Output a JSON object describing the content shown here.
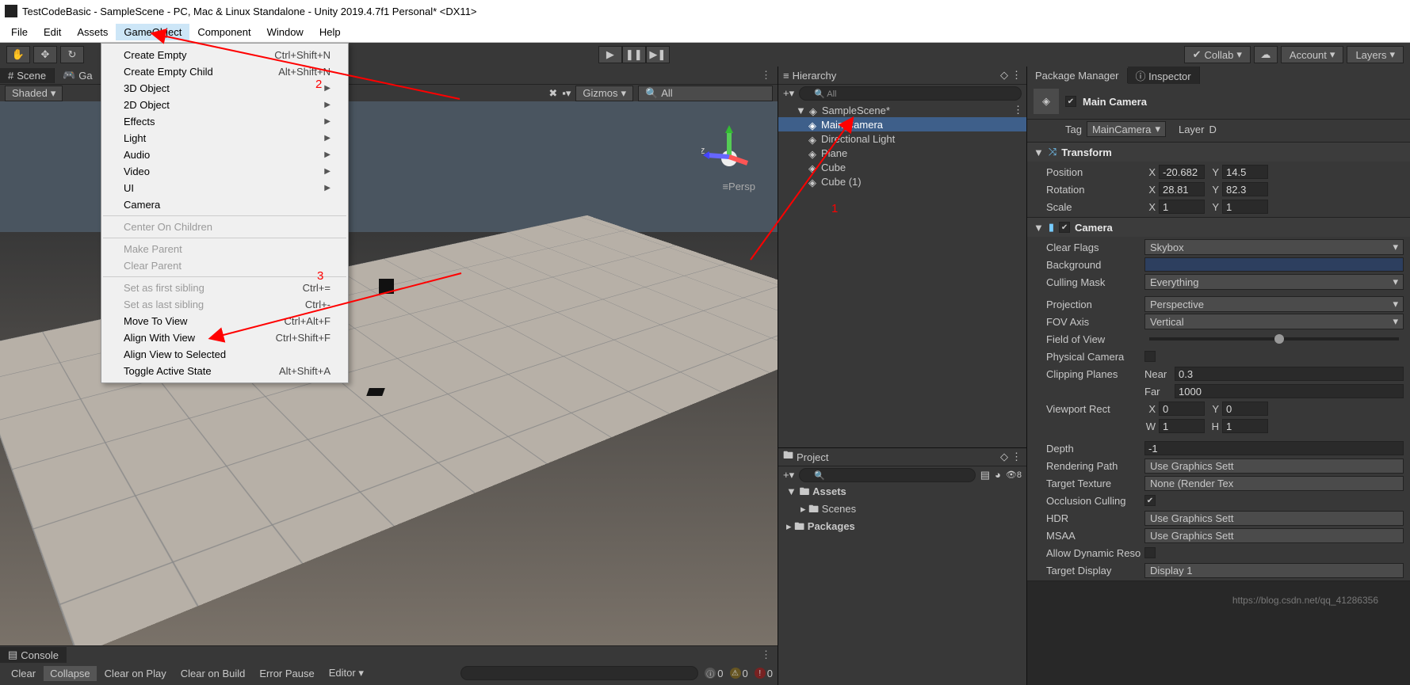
{
  "title": "TestCodeBasic - SampleScene - PC, Mac & Linux Standalone - Unity 2019.4.7f1 Personal* <DX11>",
  "menubar": [
    "File",
    "Edit",
    "Assets",
    "GameObject",
    "Component",
    "Window",
    "Help"
  ],
  "menubar_active": 3,
  "toolbar_right": {
    "collab": "Collab",
    "account": "Account",
    "layers": "Layers"
  },
  "scene_tabs": {
    "scene": "Scene",
    "game": "Ga"
  },
  "scene_toolbar": {
    "shaded": "Shaded",
    "gizmos": "Gizmos",
    "all": "All",
    "persp": "Persp"
  },
  "gameobject_menu": [
    {
      "t": "item",
      "label": "Create Empty",
      "shortcut": "Ctrl+Shift+N"
    },
    {
      "t": "item",
      "label": "Create Empty Child",
      "shortcut": "Alt+Shift+N"
    },
    {
      "t": "sub",
      "label": "3D Object"
    },
    {
      "t": "sub",
      "label": "2D Object"
    },
    {
      "t": "sub",
      "label": "Effects"
    },
    {
      "t": "sub",
      "label": "Light"
    },
    {
      "t": "sub",
      "label": "Audio"
    },
    {
      "t": "sub",
      "label": "Video"
    },
    {
      "t": "sub",
      "label": "UI"
    },
    {
      "t": "item",
      "label": "Camera"
    },
    {
      "t": "sep"
    },
    {
      "t": "item",
      "label": "Center On Children",
      "disabled": true
    },
    {
      "t": "sep"
    },
    {
      "t": "item",
      "label": "Make Parent",
      "disabled": true
    },
    {
      "t": "item",
      "label": "Clear Parent",
      "disabled": true
    },
    {
      "t": "sep"
    },
    {
      "t": "item",
      "label": "Set as first sibling",
      "shortcut": "Ctrl+=",
      "disabled": true
    },
    {
      "t": "item",
      "label": "Set as last sibling",
      "shortcut": "Ctrl+-",
      "disabled": true
    },
    {
      "t": "item",
      "label": "Move To View",
      "shortcut": "Ctrl+Alt+F"
    },
    {
      "t": "item",
      "label": "Align With View",
      "shortcut": "Ctrl+Shift+F"
    },
    {
      "t": "item",
      "label": "Align View to Selected"
    },
    {
      "t": "item",
      "label": "Toggle Active State",
      "shortcut": "Alt+Shift+A"
    }
  ],
  "hierarchy": {
    "title": "Hierarchy",
    "all": "All",
    "scene": "SampleScene*",
    "items": [
      "Main Camera",
      "Directional Light",
      "Plane",
      "Cube",
      "Cube (1)"
    ],
    "selected": 0
  },
  "project": {
    "title": "Project",
    "items": [
      "Assets",
      "Scenes",
      "Packages"
    ]
  },
  "console": {
    "title": "Console",
    "buttons": [
      "Clear",
      "Collapse",
      "Clear on Play",
      "Clear on Build",
      "Error Pause",
      "Editor"
    ],
    "counts": {
      "info": "0",
      "warn": "0",
      "err": "0"
    }
  },
  "inspector": {
    "tabs": [
      "Package Manager",
      "Inspector"
    ],
    "name": "Main Camera",
    "tag_lbl": "Tag",
    "tag_val": "MainCamera",
    "layer_lbl": "Layer",
    "layer_val": "D",
    "transform": {
      "title": "Transform",
      "position": {
        "lbl": "Position",
        "x": "-20.682",
        "y": "14.5"
      },
      "rotation": {
        "lbl": "Rotation",
        "x": "28.81",
        "y": "82.3"
      },
      "scale": {
        "lbl": "Scale",
        "x": "1",
        "y": "1"
      }
    },
    "camera": {
      "title": "Camera",
      "clear_flags": {
        "lbl": "Clear Flags",
        "val": "Skybox"
      },
      "background": {
        "lbl": "Background"
      },
      "culling": {
        "lbl": "Culling Mask",
        "val": "Everything"
      },
      "projection": {
        "lbl": "Projection",
        "val": "Perspective"
      },
      "fov_axis": {
        "lbl": "FOV Axis",
        "val": "Vertical"
      },
      "fov": {
        "lbl": "Field of View"
      },
      "phys": {
        "lbl": "Physical Camera"
      },
      "clip": {
        "lbl": "Clipping Planes",
        "near_lbl": "Near",
        "near": "0.3",
        "far_lbl": "Far",
        "far": "1000"
      },
      "viewport": {
        "lbl": "Viewport Rect",
        "x": "0",
        "y": "0",
        "w": "1",
        "h": "1"
      },
      "depth": {
        "lbl": "Depth",
        "val": "-1"
      },
      "render_path": {
        "lbl": "Rendering Path",
        "val": "Use Graphics Sett"
      },
      "target_tex": {
        "lbl": "Target Texture",
        "val": "None (Render Tex"
      },
      "occlusion": {
        "lbl": "Occlusion Culling"
      },
      "hdr": {
        "lbl": "HDR",
        "val": "Use Graphics Sett"
      },
      "msaa": {
        "lbl": "MSAA",
        "val": "Use Graphics Sett"
      },
      "dyn": {
        "lbl": "Allow Dynamic Reso"
      },
      "tgt_disp": {
        "lbl": "Target Display",
        "val": "Display 1"
      }
    }
  },
  "ann": {
    "n1": "1",
    "n2": "2",
    "n3": "3"
  },
  "watermark": "https://blog.csdn.net/qq_41286356",
  "persp_prefix": "≡"
}
